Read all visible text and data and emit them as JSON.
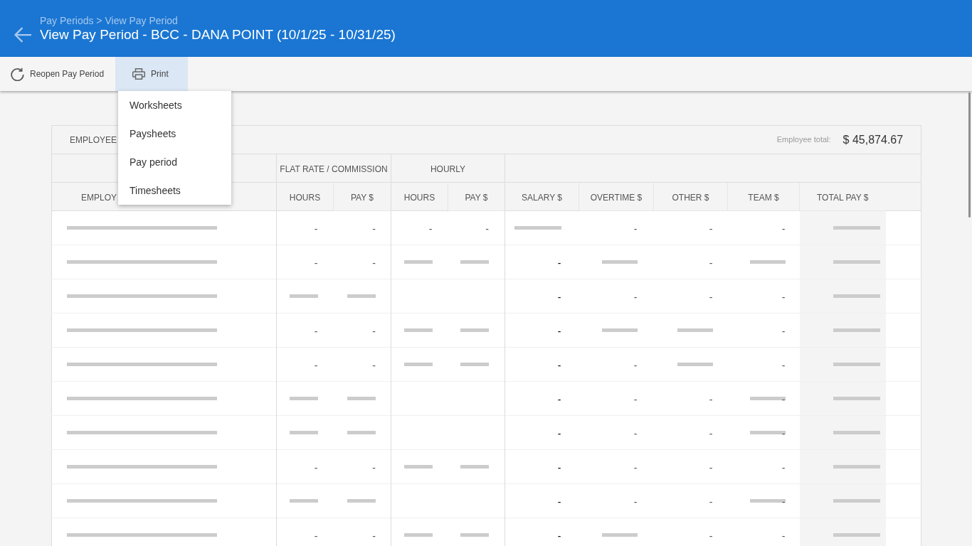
{
  "header": {
    "breadcrumb": "Pay Periods > View Pay Period",
    "title": "View Pay Period - BCC - DANA POINT (10/1/25 - 10/31/25)"
  },
  "toolbar": {
    "reopen_button": {
      "label": "Reopen Pay Period"
    },
    "print_button": {
      "label": "Print",
      "expanded": true
    }
  },
  "print_menu": {
    "items": [
      "Worksheets",
      "Paysheets",
      "Pay period",
      "Timesheets"
    ]
  },
  "table": {
    "title": "EMPLOYEE",
    "total_label": "Employee total:",
    "total_value": "$ 45,874.67",
    "column_groups": [
      {
        "columns": [
          "EMPLOY"
        ]
      },
      {
        "label": "FLAT RATE / COMMISSION",
        "columns": [
          "HOURS",
          "PAY $"
        ]
      },
      {
        "label": "HOURLY",
        "columns": [
          "HOURS",
          "PAY $"
        ]
      },
      {
        "columns": [
          "SALARY $",
          "OVERTIME $",
          "OTHER $",
          "TEAM $",
          "TOTAL PAY $"
        ]
      }
    ],
    "rows": [
      {
        "cells": [
          {
            "kind": "redacted"
          },
          {
            "kind": "text",
            "text": "-"
          },
          {
            "kind": "text",
            "text": "-"
          },
          {
            "kind": "text",
            "text": "-"
          },
          {
            "kind": "text",
            "text": "-"
          },
          {
            "kind": "redacted"
          },
          {
            "kind": "text",
            "text": "-"
          },
          {
            "kind": "text",
            "text": "-"
          },
          {
            "kind": "text",
            "text": "-"
          },
          {
            "kind": "redacted"
          }
        ]
      },
      {
        "cells": [
          {
            "kind": "redacted"
          },
          {
            "kind": "text",
            "text": "-"
          },
          {
            "kind": "text",
            "text": "-"
          },
          {
            "kind": "redacted"
          },
          {
            "kind": "redacted"
          },
          {
            "kind": "text",
            "text": "-"
          },
          {
            "kind": "redacted"
          },
          {
            "kind": "text",
            "text": "-"
          },
          {
            "kind": "redacted"
          },
          {
            "kind": "redacted"
          }
        ]
      },
      {
        "cells": [
          {
            "kind": "redacted"
          },
          {
            "kind": "redacted"
          },
          {
            "kind": "redacted"
          },
          {
            "kind": "blank"
          },
          {
            "kind": "blank"
          },
          {
            "kind": "text",
            "text": "-"
          },
          {
            "kind": "text",
            "text": "-"
          },
          {
            "kind": "text",
            "text": "-"
          },
          {
            "kind": "text",
            "text": "-"
          },
          {
            "kind": "redacted"
          }
        ]
      },
      {
        "cells": [
          {
            "kind": "redacted"
          },
          {
            "kind": "text",
            "text": "-"
          },
          {
            "kind": "text",
            "text": "-"
          },
          {
            "kind": "redacted"
          },
          {
            "kind": "redacted"
          },
          {
            "kind": "text",
            "text": "-"
          },
          {
            "kind": "redacted"
          },
          {
            "kind": "redacted"
          },
          {
            "kind": "text",
            "text": "-"
          },
          {
            "kind": "redacted"
          }
        ]
      },
      {
        "cells": [
          {
            "kind": "redacted"
          },
          {
            "kind": "text",
            "text": "-"
          },
          {
            "kind": "text",
            "text": "-"
          },
          {
            "kind": "redacted"
          },
          {
            "kind": "redacted"
          },
          {
            "kind": "text",
            "text": "-"
          },
          {
            "kind": "text",
            "text": "-"
          },
          {
            "kind": "redacted"
          },
          {
            "kind": "text",
            "text": "-"
          },
          {
            "kind": "redacted"
          }
        ]
      },
      {
        "cells": [
          {
            "kind": "redacted"
          },
          {
            "kind": "redacted"
          },
          {
            "kind": "redacted"
          },
          {
            "kind": "blank"
          },
          {
            "kind": "blank"
          },
          {
            "kind": "text",
            "text": "-"
          },
          {
            "kind": "text",
            "text": "-"
          },
          {
            "kind": "text",
            "text": "-"
          },
          {
            "kind": "redacted",
            "text": "-"
          },
          {
            "kind": "redacted"
          }
        ]
      },
      {
        "cells": [
          {
            "kind": "redacted"
          },
          {
            "kind": "redacted"
          },
          {
            "kind": "redacted"
          },
          {
            "kind": "blank"
          },
          {
            "kind": "blank"
          },
          {
            "kind": "text",
            "text": "-"
          },
          {
            "kind": "text",
            "text": "-"
          },
          {
            "kind": "text",
            "text": "-"
          },
          {
            "kind": "redacted",
            "text": "-"
          },
          {
            "kind": "redacted"
          }
        ]
      },
      {
        "cells": [
          {
            "kind": "redacted"
          },
          {
            "kind": "text",
            "text": "-"
          },
          {
            "kind": "text",
            "text": "-"
          },
          {
            "kind": "redacted"
          },
          {
            "kind": "redacted"
          },
          {
            "kind": "text",
            "text": "-"
          },
          {
            "kind": "text",
            "text": "-"
          },
          {
            "kind": "text",
            "text": "-"
          },
          {
            "kind": "text",
            "text": "-"
          },
          {
            "kind": "redacted"
          }
        ]
      },
      {
        "cells": [
          {
            "kind": "redacted"
          },
          {
            "kind": "redacted"
          },
          {
            "kind": "redacted"
          },
          {
            "kind": "blank"
          },
          {
            "kind": "blank"
          },
          {
            "kind": "text",
            "text": "-"
          },
          {
            "kind": "text",
            "text": "-"
          },
          {
            "kind": "text",
            "text": "-"
          },
          {
            "kind": "redacted",
            "text": "-"
          },
          {
            "kind": "redacted"
          }
        ]
      },
      {
        "cells": [
          {
            "kind": "redacted"
          },
          {
            "kind": "text",
            "text": "-"
          },
          {
            "kind": "text",
            "text": "-"
          },
          {
            "kind": "redacted"
          },
          {
            "kind": "redacted"
          },
          {
            "kind": "text",
            "text": "-"
          },
          {
            "kind": "redacted"
          },
          {
            "kind": "text",
            "text": "-"
          },
          {
            "kind": "text",
            "text": "-"
          },
          {
            "kind": "redacted"
          }
        ]
      }
    ]
  }
}
